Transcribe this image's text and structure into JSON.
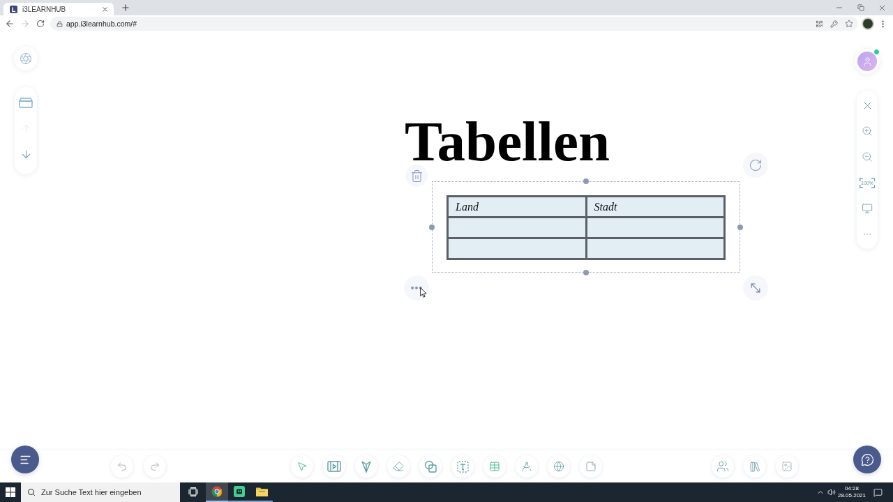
{
  "browser": {
    "tab": {
      "title": "i3LEARNHUB"
    },
    "nav": {
      "back_disabled": false,
      "forward_disabled": true
    },
    "address_bar": {
      "url": "app.i3learnhub.com/#"
    }
  },
  "left_rail": {
    "page_buttons": [
      {
        "kind": "up",
        "disabled": true
      },
      {
        "kind": "down",
        "disabled": false
      }
    ]
  },
  "right_rail": {
    "user": {
      "online": true
    },
    "zoom_label": "100%"
  },
  "board": {
    "title": "Tabellen",
    "table": {
      "selected": true,
      "rows": [
        {
          "kind": "text",
          "cells": [
            "Land",
            "Stadt"
          ]
        },
        {
          "kind": "blank"
        },
        {
          "kind": "blank"
        }
      ]
    }
  },
  "taskbar": {
    "search": {
      "placeholder": "Zur Suche Text hier eingeben"
    },
    "apps": [
      {
        "kind": "browser",
        "selected": true
      },
      {
        "kind": "app",
        "selected": false
      },
      {
        "kind": "folder",
        "selected": false
      }
    ],
    "clock": {
      "time": "04:28",
      "date": "28.05.2021"
    }
  }
}
